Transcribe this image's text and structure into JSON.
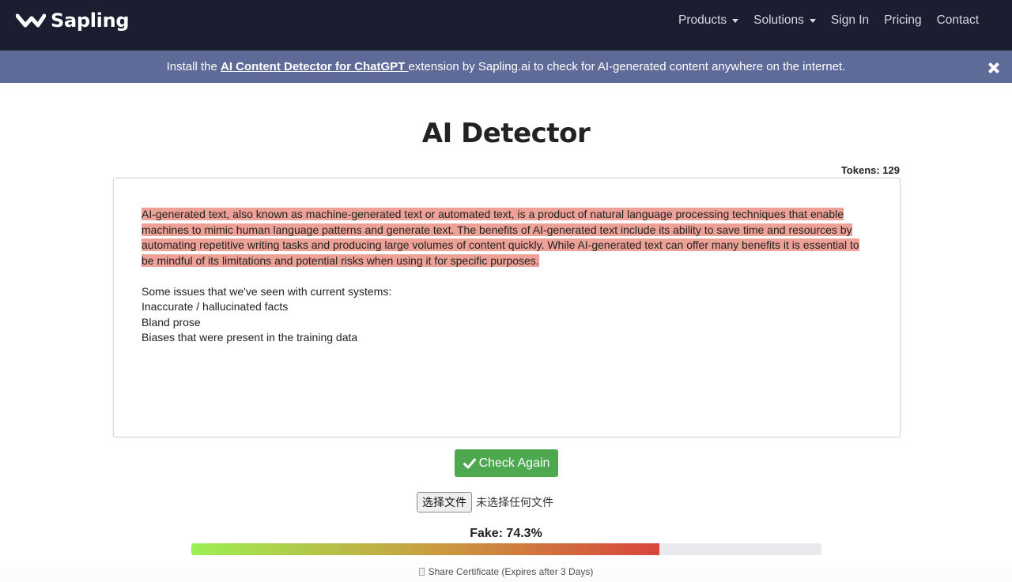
{
  "navbar": {
    "brand": "Sapling",
    "brand_icon": "sapling-logo-icon",
    "links": [
      {
        "label": "Products",
        "dropdown": true
      },
      {
        "label": "Solutions",
        "dropdown": true
      },
      {
        "label": "Sign In",
        "dropdown": false
      },
      {
        "label": "Pricing",
        "dropdown": false
      },
      {
        "label": "Contact",
        "dropdown": false
      }
    ]
  },
  "banner": {
    "prefix": "Install the ",
    "link": "AI Content Detector for ChatGPT ",
    "suffix": " extension by Sapling.ai to check for AI-generated content anywhere on the internet.",
    "close_icon": "close-icon"
  },
  "page": {
    "title": "AI Detector",
    "tokens": "Tokens: 129"
  },
  "editor": {
    "highlighted_lines": [
      "AI-generated text, also known as machine-generated text or automated text, is a product of natural language processing techniques that enable ",
      "machines to mimic human language patterns and generate text. The benefits of AI-generated text include its ability to save time and resources by ",
      "automating repetitive writing tasks and producing large volumes of content quickly. While AI-generated text can offer many benefits it is essential to ",
      "be mindful of its limitations and potential risks when using it for specific purposes."
    ],
    "plain_lines": [
      "Some issues that we've seen with current systems:",
      "Inaccurate / hallucinated facts",
      "Bland prose",
      "Biases that were present in the training data"
    ],
    "highlight_color": "#eda197"
  },
  "actions": {
    "check_label": "Check Again",
    "check_icon": "checkmark-icon",
    "file_button": "选择文件",
    "file_status": "未选择任何文件"
  },
  "result": {
    "score_label": "Fake: 74.3%",
    "fake_fraction": 0.743,
    "share_label": "Share Certificate (Expires after 3 Days)"
  },
  "colors": {
    "nav_bg": "#1b1e30",
    "banner_bg": "#5e6a98",
    "button_green": "#4ea84f",
    "bar_start": "#9bf052",
    "bar_end": "#d9453d"
  }
}
